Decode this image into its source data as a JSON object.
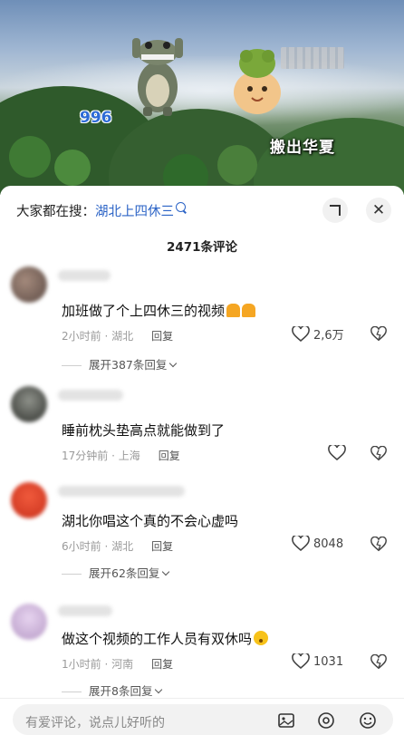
{
  "video": {
    "overlay_left": "996",
    "overlay_right": "搬出华夏"
  },
  "header": {
    "search_prefix": "大家都在搜：",
    "search_term": "湖北上四休三",
    "close_glyph": "✕"
  },
  "comment_count": "2471条评论",
  "comments": [
    {
      "text": "加班做了个上四休三的视频",
      "time": "2小时前",
      "location": "湖北",
      "reply": "回复",
      "likes": "2,6万",
      "expand": "展开387条回复",
      "emoji": "pray-hands"
    },
    {
      "text": "睡前枕头垫高点就能做到了",
      "time": "17分钟前",
      "location": "上海",
      "reply": "回复",
      "likes": "",
      "expand": ""
    },
    {
      "text": "湖北你唱这个真的不会心虚吗",
      "time": "6小时前",
      "location": "湖北",
      "reply": "回复",
      "likes": "8048",
      "expand": "展开62条回复"
    },
    {
      "text": "做这个视频的工作人员有双休吗",
      "time": "1小时前",
      "location": "河南",
      "reply": "回复",
      "likes": "1031",
      "expand": "展开8条回复",
      "emoji": "surprised-face"
    }
  ],
  "input": {
    "placeholder": "有爱评论，说点儿好听的"
  },
  "icons": [
    "search-icon",
    "expand-icon",
    "close-icon",
    "heart-icon",
    "dislike-icon",
    "image-icon",
    "at-icon",
    "emoji-icon"
  ],
  "colors": {
    "link": "#2b63c6",
    "meta": "#9a9a9a"
  }
}
